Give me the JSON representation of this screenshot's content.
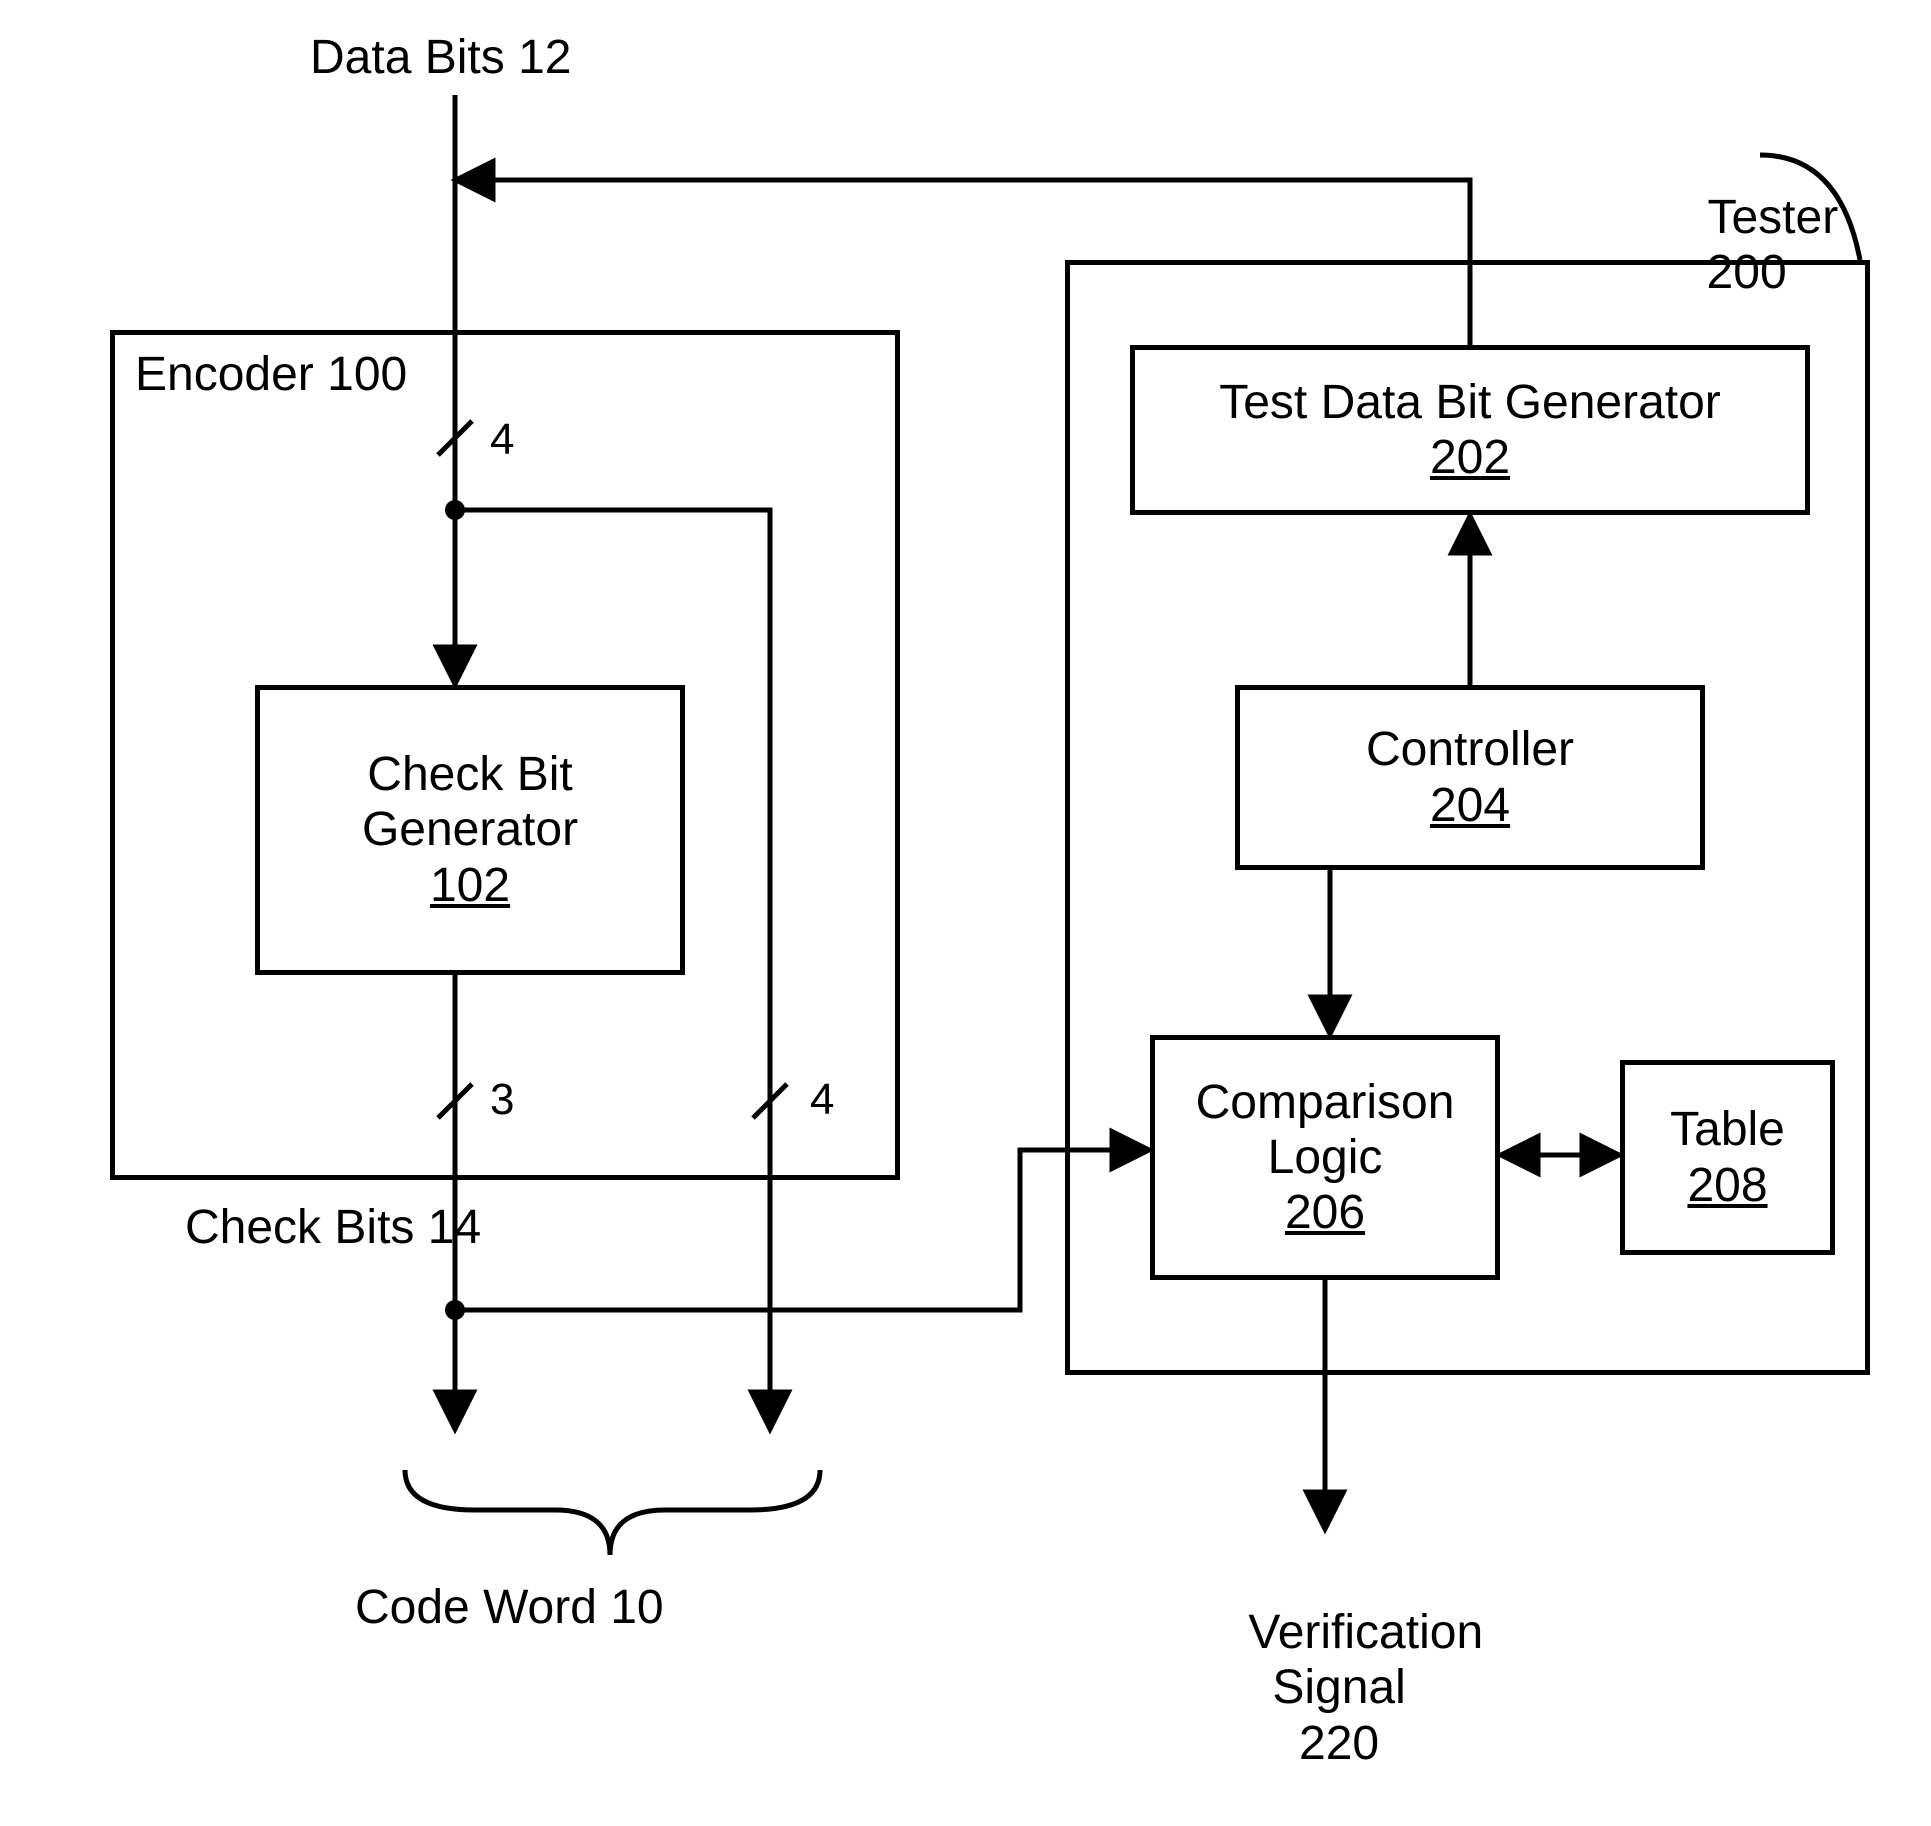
{
  "labels": {
    "data_bits": "Data Bits 12",
    "check_bits": "Check Bits 14",
    "code_word": "Code Word 10",
    "tester_text": "Tester",
    "tester_num": "200",
    "verification_l1": "Verification",
    "verification_l2": "Signal",
    "verification_l3": "220"
  },
  "bus_widths": {
    "in": "4",
    "check_out": "3",
    "data_passthru": "4"
  },
  "blocks": {
    "encoder": {
      "title": "Encoder",
      "num": "100"
    },
    "check_bit_gen": {
      "l1": "Check Bit",
      "l2": "Generator",
      "num": "102"
    },
    "test_data_gen": {
      "l1": "Test Data Bit Generator",
      "num": "202"
    },
    "controller": {
      "l1": "Controller",
      "num": "204"
    },
    "comparison": {
      "l1": "Comparison",
      "l2": "Logic",
      "num": "206"
    },
    "table": {
      "l1": "Table",
      "num": "208"
    }
  }
}
